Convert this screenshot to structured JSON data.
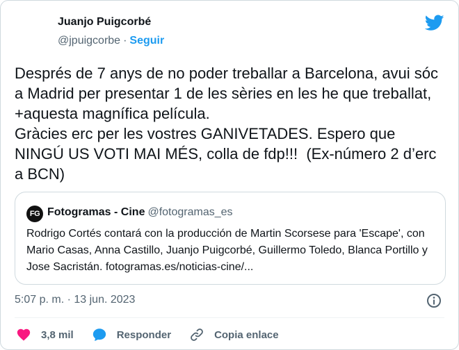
{
  "author": {
    "name": "Juanjo Puigcorbé",
    "handle": "@jpuigcorbe",
    "separator": "·",
    "follow_label": "Seguir"
  },
  "tweet": {
    "text": "Després de 7 anys de no poder treballar a Barcelona, avui sóc a Madrid per presentar 1 de les sèries en les he que treballat, +aquesta magnífica película.\nGràcies erc per les vostres GANIVETADES. Espero que NINGÚ US VOTI MAI MÉS, colla de fdp!!!  (Ex-número 2 d’erc a BCN)",
    "timestamp": "5:07 p. m. · 13 jun. 2023"
  },
  "quote": {
    "logo_text": "FG",
    "name": "Fotogramas - Cine",
    "handle": "@fotogramas_es",
    "text": "Rodrigo Cortés contará con la producción de Martin Scorsese para 'Escape', con Mario Casas, Anna Castillo, Juanjo Puigcorbé, Guillermo Toledo, Blanca Portillo y Jose Sacristán. fotogramas.es/noticias-cine/..."
  },
  "actions": {
    "like_count": "3,8 mil",
    "reply_label": "Responder",
    "copy_label": "Copia enlace"
  },
  "colors": {
    "accent": "#1d9bf0",
    "like": "#f91880",
    "muted": "#536471",
    "border": "#cfd9de"
  },
  "icons": [
    "twitter-bird-icon",
    "info-icon",
    "heart-icon",
    "reply-bubble-icon",
    "link-icon"
  ]
}
